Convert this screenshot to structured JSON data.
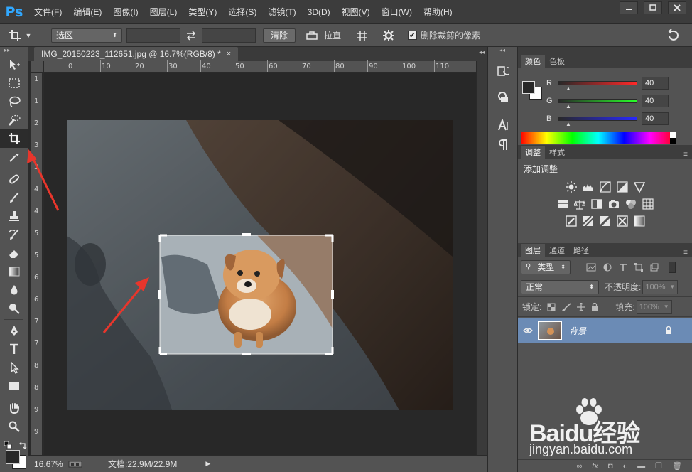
{
  "menubar": {
    "logo": "Ps",
    "items": [
      "文件(F)",
      "编辑(E)",
      "图像(I)",
      "图层(L)",
      "类型(Y)",
      "选择(S)",
      "滤镜(T)",
      "3D(D)",
      "视图(V)",
      "窗口(W)",
      "帮助(H)"
    ]
  },
  "options": {
    "ratio_select": "选区",
    "clear_label": "清除",
    "straighten_label": "拉直",
    "delete_cropped_label": "删除裁剪的像素",
    "delete_cropped_checked": true
  },
  "document": {
    "tab_title": "IMG_20150223_112651.jpg @ 16.7%(RGB/8) *",
    "ruler_h": [
      "0",
      "10",
      "20",
      "30",
      "40",
      "50",
      "60",
      "70",
      "80",
      "90",
      "100",
      "110"
    ],
    "ruler_v": [
      "1",
      "1",
      "2",
      "3",
      "3",
      "4",
      "4",
      "5",
      "5",
      "6",
      "6",
      "7",
      "7",
      "8",
      "8",
      "9",
      "9"
    ]
  },
  "status": {
    "zoom": "16.67%",
    "doc_size": "文档:22.9M/22.9M"
  },
  "color_panel": {
    "tabs": [
      "颜色",
      "色板"
    ],
    "channels": [
      {
        "label": "R",
        "value": "40"
      },
      {
        "label": "G",
        "value": "40"
      },
      {
        "label": "B",
        "value": "40"
      }
    ]
  },
  "adjust_panel": {
    "tabs": [
      "调整",
      "样式"
    ],
    "title": "添加调整"
  },
  "layers_panel": {
    "tabs": [
      "图层",
      "通道",
      "路径"
    ],
    "filter_label": "类型",
    "blend_mode": "正常",
    "opacity_label": "不透明度:",
    "opacity_value": "100%",
    "lock_label": "锁定:",
    "fill_label": "填充:",
    "fill_value": "100%",
    "layer_name": "背景"
  },
  "watermark": {
    "brand": "Baidu经验",
    "url": "jingyan.baidu.com"
  },
  "colors": {
    "panel_bg": "#535353",
    "canvas_bg": "#282828",
    "accent_red": "#e8362c",
    "layer_selected": "#6b8bb5"
  }
}
